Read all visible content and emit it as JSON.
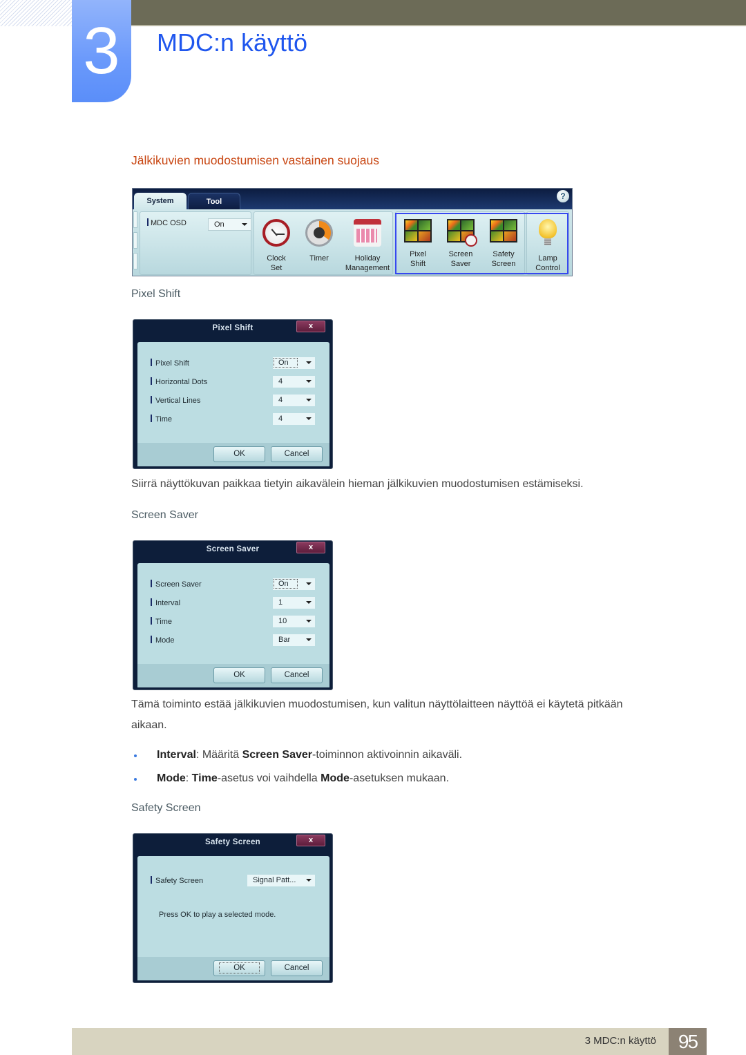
{
  "header": {
    "chapter_number": "3",
    "chapter_title": "MDC:n käyttö"
  },
  "section_heading": "Jälkikuvien muodostumisen vastainen suojaus",
  "toolbar": {
    "tabs": [
      {
        "label": "System",
        "active": true
      },
      {
        "label": "Tool",
        "active": false
      }
    ],
    "help_label": "?",
    "mdc_osd_label": "MDC OSD",
    "mdc_osd_value": "On",
    "buttons": [
      {
        "line1": "Clock",
        "line2": "Set",
        "icon": "clock-icon"
      },
      {
        "line1": "Timer",
        "line2": "",
        "icon": "timer-icon"
      },
      {
        "line1": "Holiday",
        "line2": "Management",
        "icon": "calendar-icon"
      },
      {
        "line1": "Pixel",
        "line2": "Shift",
        "icon": "pixel-shift-icon"
      },
      {
        "line1": "Screen",
        "line2": "Saver",
        "icon": "screen-saver-icon"
      },
      {
        "line1": "Safety",
        "line2": "Screen",
        "icon": "safety-screen-icon"
      },
      {
        "line1": "Lamp",
        "line2": "Control",
        "icon": "lightbulb-icon"
      }
    ],
    "highlight_color": "#3748f0"
  },
  "pixel_shift": {
    "subheading": "Pixel Shift",
    "dialog_title": "Pixel Shift",
    "close_label": "x",
    "rows": [
      {
        "label": "Pixel Shift",
        "value": "On"
      },
      {
        "label": "Horizontal Dots",
        "value": "4"
      },
      {
        "label": "Vertical Lines",
        "value": "4"
      },
      {
        "label": "Time",
        "value": "4"
      }
    ],
    "ok_label": "OK",
    "cancel_label": "Cancel",
    "description": "Siirrä näyttökuvan paikkaa tietyin aikavälein hieman jälkikuvien muodostumisen estämiseksi."
  },
  "screen_saver": {
    "subheading": "Screen Saver",
    "dialog_title": "Screen Saver",
    "close_label": "x",
    "rows": [
      {
        "label": "Screen Saver",
        "value": "On"
      },
      {
        "label": "Interval",
        "value": "1"
      },
      {
        "label": "Time",
        "value": "10"
      },
      {
        "label": "Mode",
        "value": "Bar"
      }
    ],
    "ok_label": "OK",
    "cancel_label": "Cancel",
    "description_line1": "Tämä toiminto estää jälkikuvien muodostumisen, kun valitun näyttölaitteen näyttöä ei käytetä pitkään",
    "description_line2": "aikaan.",
    "bullets": [
      {
        "term": "Interval",
        "sep": ": Määritä ",
        "term2": "Screen Saver",
        "rest": "-toiminnon aktivoinnin aikaväli."
      },
      {
        "term": "Mode",
        "sep": ": ",
        "term2": "Time",
        "mid": "-asetus voi vaihdella ",
        "term3": "Mode",
        "rest": "-asetuksen mukaan."
      }
    ]
  },
  "safety_screen": {
    "subheading": "Safety Screen",
    "dialog_title": "Safety Screen",
    "close_label": "x",
    "row_label": "Safety Screen",
    "row_value": "Signal Patt...",
    "note": "Press OK to play a selected mode.",
    "ok_label": "OK",
    "cancel_label": "Cancel"
  },
  "footer": {
    "text": "3 MDC:n käyttö",
    "page_number": "95"
  }
}
